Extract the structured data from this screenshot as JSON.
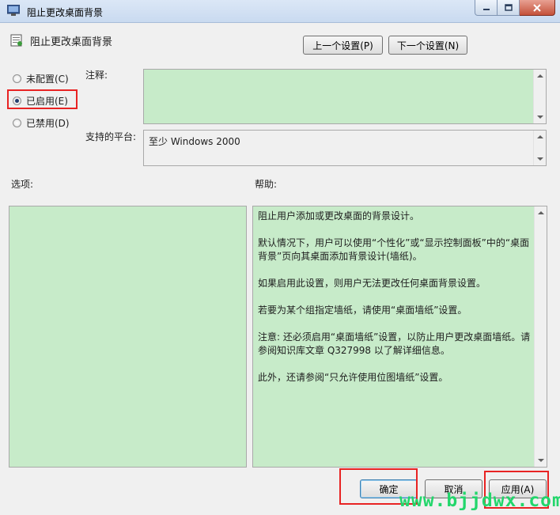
{
  "window": {
    "title": "阻止更改桌面背景",
    "min_icon": "minimize-icon",
    "max_icon": "maximize-icon",
    "close_icon": "close-icon"
  },
  "header": {
    "policy_name": "阻止更改桌面背景",
    "prev_button": "上一个设置(P)",
    "next_button": "下一个设置(N)"
  },
  "state": {
    "options": [
      {
        "label": "未配置(C)",
        "checked": false
      },
      {
        "label": "已启用(E)",
        "checked": true
      },
      {
        "label": "已禁用(D)",
        "checked": false
      }
    ]
  },
  "comment": {
    "label": "注释:",
    "value": ""
  },
  "platform": {
    "label": "支持的平台:",
    "value": "至少 Windows 2000"
  },
  "options_section": {
    "label": "选项:"
  },
  "help_section": {
    "label": "帮助:",
    "paragraphs": [
      "阻止用户添加或更改桌面的背景设计。",
      "默认情况下，用户可以使用“个性化”或“显示控制面板”中的“桌面背景”页向其桌面添加背景设计(墙纸)。",
      "如果启用此设置，则用户无法更改任何桌面背景设置。",
      "若要为某个组指定墙纸，请使用“桌面墙纸”设置。",
      "注意: 还必须启用“桌面墙纸”设置，以防止用户更改桌面墙纸。请参阅知识库文章 Q327998 以了解详细信息。",
      "此外，还请参阅“只允许使用位图墙纸”设置。"
    ]
  },
  "footer": {
    "ok": "确定",
    "cancel": "取消",
    "apply": "应用(A)"
  },
  "watermark": "www.bjjdwx.com",
  "colors": {
    "panel_green": "#c7ebc9",
    "highlight_red": "#e82323",
    "watermark_green": "#22d66b"
  }
}
